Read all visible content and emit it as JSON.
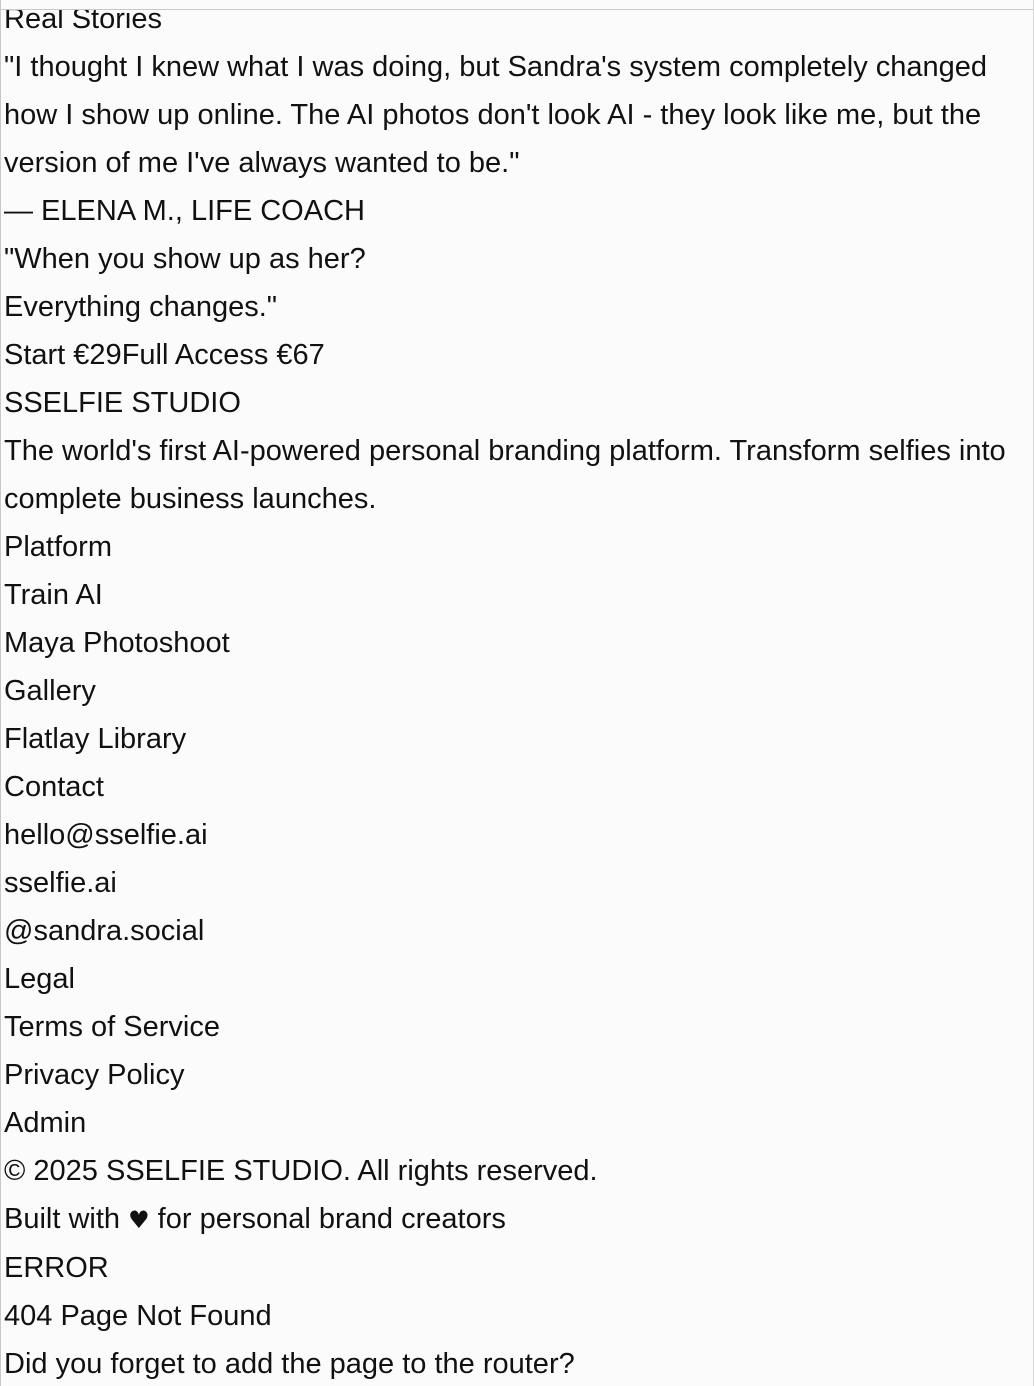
{
  "stories": {
    "section_title": "Real Stories",
    "quote": "\"I thought I knew what I was doing, but Sandra's system completely changed how I show up online. The AI photos don't look AI - they look like me, but the version of me I've always wanted to be.\"",
    "attribution": "— ELENA M., LIFE COACH"
  },
  "cta": {
    "quote_line1": "\"When you show up as her?",
    "quote_line2": "Everything changes.\"",
    "start_label": "Start €29",
    "full_access_label": "Full Access €67"
  },
  "footer": {
    "brand": "SSELFIE STUDIO",
    "tagline": "The world's first AI-powered personal branding platform. Transform selfies into complete business launches.",
    "platform": {
      "heading": "Platform",
      "links": [
        "Train AI",
        "Maya Photoshoot",
        "Gallery",
        "Flatlay Library"
      ]
    },
    "contact": {
      "heading": "Contact",
      "links": [
        "hello@sselfie.ai",
        "sselfie.ai",
        "@sandra.social"
      ]
    },
    "legal": {
      "heading": "Legal",
      "links": [
        "Terms of Service",
        "Privacy Policy",
        "Admin"
      ]
    },
    "copyright": "© 2025 SSELFIE STUDIO. All rights reserved.",
    "built_with_prefix": "Built with ",
    "heart_icon": "heart-icon",
    "built_with_suffix": " for personal brand creators"
  },
  "error": {
    "label": "ERROR",
    "title": "404 Page Not Found",
    "message": "Did you forget to add the page to the router?"
  }
}
